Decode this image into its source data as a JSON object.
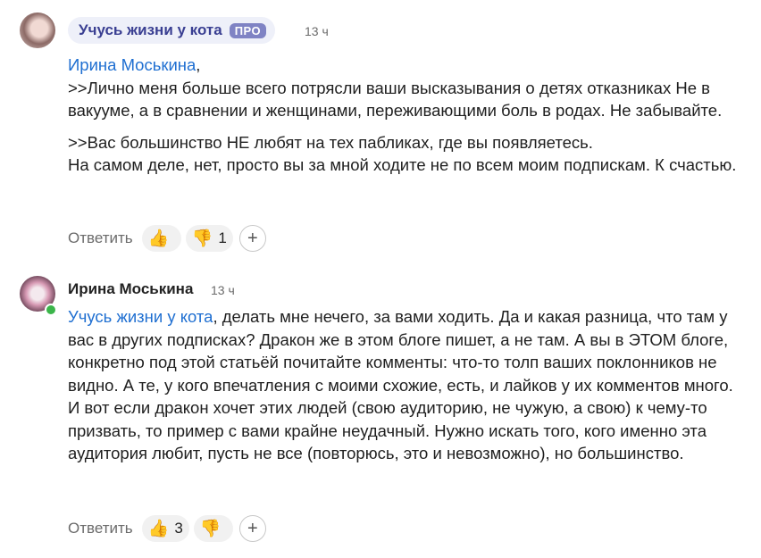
{
  "comments": [
    {
      "author": "Учусь жизни у кота",
      "badge": "ПРО",
      "time": "13 ч",
      "mention": "Ирина Моськина",
      "after_mention": ",",
      "text1": "\n>>Лично меня больше всего потрясли ваши высказывания о детях отказниках Не в вакууме, а в сравнении и женщинами, переживающими боль в родах. Не забывайте.",
      "text2": ">>Вас большинство НЕ любят на тех пабликах, где вы появляетесь.\nНа самом деле, нет, просто вы за мной ходите не по всем моим подпискам. К счастью.",
      "reply_label": "Ответить",
      "like_emoji": "👍",
      "like_count": "",
      "dislike_emoji": "👎",
      "dislike_count": "1",
      "add_reaction": "+"
    },
    {
      "author": "Ирина Моськина",
      "time": "13 ч",
      "mention": "Учусь жизни у кота",
      "text1": ", делать мне нечего, за вами ходить. Да и какая разница, что там у вас в других подписках? Дракон же в этом блоге пишет, а не там. А вы в ЭТОМ блоге, конкретно под этой статьёй почитайте комменты: что-то толп ваших поклонников не видно. А те, у кого впечатления с моими схожие, есть, и лайков у их комментов много.\nИ вот если дракон хочет этих людей (свою аудиторию, не чужую, а свою) к чему-то призвать, то пример с вами крайне неудачный. Нужно искать того, кого именно эта аудитория любит, пусть не все (повторюсь, это и невозможно), но большинство.",
      "reply_label": "Ответить",
      "like_emoji": "👍",
      "like_count": "3",
      "dislike_emoji": "👎",
      "dislike_count": "",
      "add_reaction": "+"
    }
  ],
  "colors": {
    "mention": "#1f6fd1",
    "author_chip_bg": "#eef0f9",
    "author_chip_text": "#3a3f92",
    "pro_badge_bg": "#7f83c4",
    "online": "#3bb54a"
  }
}
